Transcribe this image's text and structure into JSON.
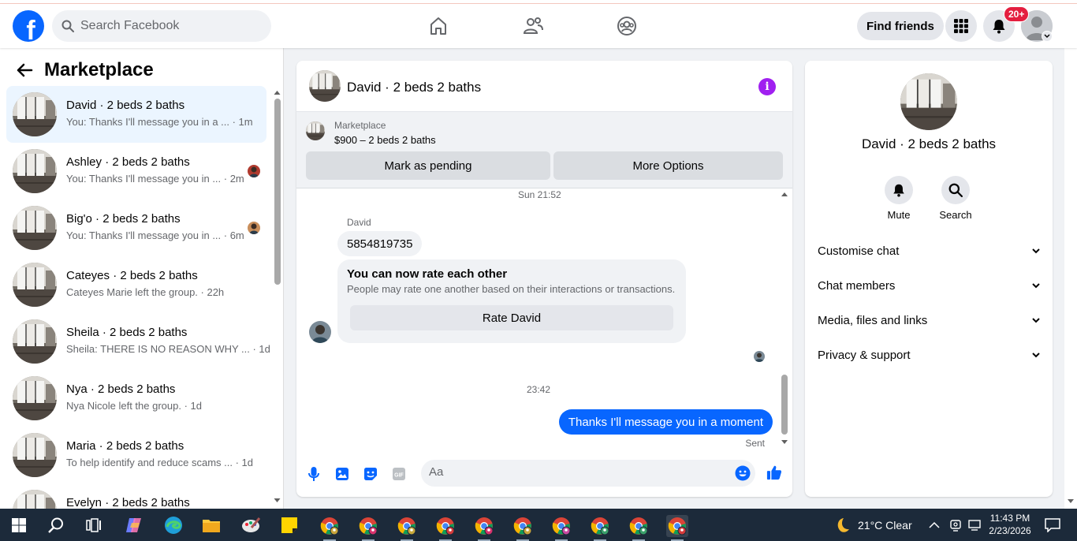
{
  "header": {
    "logo_letter": "f",
    "search_placeholder": "Search Facebook",
    "find_friends": "Find friends",
    "notif_count": "20+"
  },
  "sidebar": {
    "title": "Marketplace",
    "conversations": [
      {
        "name": "David · 2 beds 2 baths",
        "preview": "You: Thanks I'll message you in a ...  · 1m",
        "active": true
      },
      {
        "name": "Ashley · 2 beds 2 baths",
        "preview": "You: Thanks I'll message you in ... · 2m"
      },
      {
        "name": "Big'o · 2 beds 2 baths",
        "preview": "You: Thanks I'll message you in ... · 6m"
      },
      {
        "name": "Cateyes · 2 beds 2 baths",
        "preview": "Cateyes Marie left the group. · 22h"
      },
      {
        "name": "Sheila · 2 beds 2 baths",
        "preview": "Sheila: THERE IS NO REASON WHY ... · 1d"
      },
      {
        "name": "Nya · 2 beds 2 baths",
        "preview": "Nya Nicole left the group. · 1d"
      },
      {
        "name": "Maria · 2 beds 2 baths",
        "preview": "To help identify and reduce scams ...  · 1d"
      },
      {
        "name": "Evelyn · 2 beds 2 baths",
        "preview": ""
      }
    ]
  },
  "chat": {
    "title": "David · 2 beds 2 baths",
    "marketplace_label": "Marketplace",
    "listing": "$900 – 2 beds 2 baths",
    "mark_pending": "Mark as pending",
    "more_options": "More Options",
    "time1": "Sun 21:52",
    "sender": "David",
    "phone_msg": "5854819735",
    "rate_title": "You can now rate each other",
    "rate_desc": "People may rate one another based on their interactions or transactions.",
    "rate_button": "Rate David",
    "time2": "23:42",
    "my_msg": "Thanks I'll message you in a moment",
    "sent": "Sent",
    "input_placeholder": "Aa"
  },
  "right_panel": {
    "name": "David · 2 beds 2 baths",
    "mute": "Mute",
    "search": "Search",
    "rows": [
      "Customise chat",
      "Chat members",
      "Media, files and links",
      "Privacy & support"
    ]
  },
  "taskbar": {
    "weather": "21°C  Clear",
    "time": "11:43 PM",
    "date": "2/23/2026"
  },
  "colors": {
    "brand": "#0866ff",
    "info": "#a020f0",
    "badge": "#e41e3f"
  }
}
